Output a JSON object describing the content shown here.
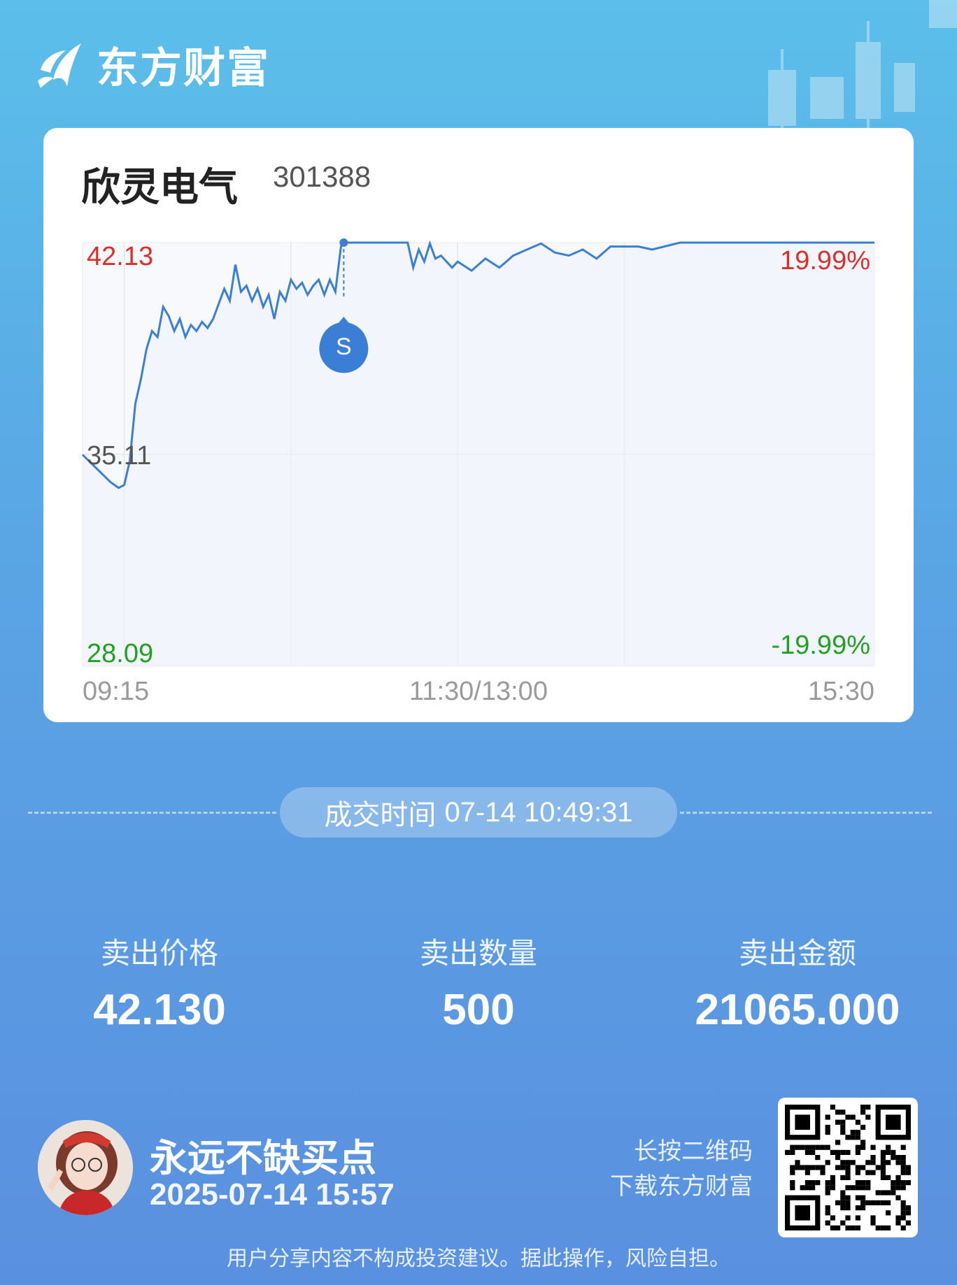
{
  "brand": {
    "name": "东方财富",
    "logo_icon": "eastmoney-logo-icon"
  },
  "stock": {
    "name": "欣灵电气",
    "code": "301388"
  },
  "chart_data": {
    "type": "line",
    "y_labels": {
      "high": "42.13",
      "mid": "35.11",
      "low": "28.09"
    },
    "pct_labels": {
      "high": "19.99%",
      "low": "-19.99%"
    },
    "x_labels": [
      "09:15",
      "11:30/13:00",
      "15:30"
    ],
    "ylim": [
      28.09,
      42.13
    ],
    "trade_marker": {
      "label": "S",
      "time": "10:49",
      "price": 42.13
    },
    "grid": true,
    "colors": {
      "line": "#3a7fd5",
      "up": "#d9302c",
      "down": "#21a025",
      "axis": "#9a9a9a"
    },
    "series": [
      {
        "x": [
          "09:15",
          "09:25",
          "09:28",
          "09:30",
          "09:32",
          "09:34",
          "09:36",
          "09:38",
          "09:40",
          "09:42",
          "09:44",
          "09:46",
          "09:48",
          "09:50",
          "09:52",
          "09:54",
          "09:56",
          "09:58",
          "10:00",
          "10:02",
          "10:04",
          "10:06",
          "10:08",
          "10:10",
          "10:12",
          "10:14",
          "10:16",
          "10:18",
          "10:20",
          "10:22",
          "10:24",
          "10:26",
          "10:28",
          "10:30",
          "10:32",
          "10:34",
          "10:36",
          "10:38",
          "10:40",
          "10:42",
          "10:44",
          "10:46",
          "10:48",
          "10:49",
          "10:52",
          "10:56",
          "11:00",
          "11:04",
          "11:08",
          "11:12",
          "11:14",
          "11:16",
          "11:18",
          "11:20",
          "11:22",
          "11:24",
          "11:26",
          "11:28",
          "11:30",
          "13:05",
          "13:10",
          "13:15",
          "13:20",
          "13:25",
          "13:30",
          "13:35",
          "13:40",
          "13:45",
          "13:50",
          "13:55",
          "14:00",
          "14:05",
          "14:10",
          "14:20",
          "15:00",
          "15:30"
        ],
        "values": [
          35.1,
          34.2,
          34.0,
          34.1,
          34.9,
          36.8,
          37.6,
          38.6,
          39.2,
          39.0,
          40.0,
          39.7,
          39.2,
          39.6,
          39.0,
          39.4,
          39.2,
          39.5,
          39.3,
          39.6,
          40.1,
          40.6,
          40.2,
          41.4,
          40.5,
          40.7,
          40.2,
          40.6,
          40.0,
          40.4,
          39.6,
          40.5,
          40.2,
          40.9,
          40.6,
          40.8,
          40.4,
          40.7,
          40.9,
          40.4,
          40.9,
          40.5,
          42.0,
          42.13,
          42.13,
          42.13,
          42.13,
          42.13,
          42.13,
          42.13,
          41.3,
          41.9,
          41.5,
          42.1,
          41.6,
          41.7,
          41.5,
          41.3,
          41.5,
          41.2,
          41.6,
          41.3,
          41.7,
          41.9,
          42.1,
          41.8,
          41.7,
          41.9,
          41.6,
          42.0,
          42.0,
          42.0,
          41.9,
          42.13,
          42.13,
          42.13
        ]
      }
    ]
  },
  "trade": {
    "time_label": "成交时间",
    "time_value": "07-14 10:49:31",
    "stats": [
      {
        "label": "卖出价格",
        "value": "42.130"
      },
      {
        "label": "卖出数量",
        "value": "500"
      },
      {
        "label": "卖出金额",
        "value": "21065.000"
      }
    ]
  },
  "user": {
    "name": "永远不缺买点",
    "date": "2025-07-14 15:57",
    "avatar_icon": "avatar"
  },
  "qr": {
    "line1": "长按二维码",
    "line2": "下载东方财富",
    "icon": "qr-code-icon"
  },
  "disclaimer": "用户分享内容不构成投资建议。据此操作，风险自担。"
}
